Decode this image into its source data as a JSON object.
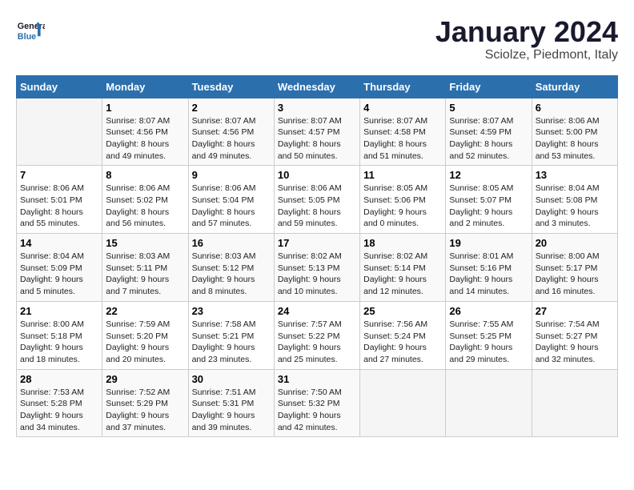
{
  "header": {
    "logo_general": "General",
    "logo_blue": "Blue",
    "month": "January 2024",
    "location": "Sciolze, Piedmont, Italy"
  },
  "weekdays": [
    "Sunday",
    "Monday",
    "Tuesday",
    "Wednesday",
    "Thursday",
    "Friday",
    "Saturday"
  ],
  "weeks": [
    [
      {
        "day": "",
        "sunrise": "",
        "sunset": "",
        "daylight": ""
      },
      {
        "day": "1",
        "sunrise": "Sunrise: 8:07 AM",
        "sunset": "Sunset: 4:56 PM",
        "daylight": "Daylight: 8 hours and 49 minutes."
      },
      {
        "day": "2",
        "sunrise": "Sunrise: 8:07 AM",
        "sunset": "Sunset: 4:56 PM",
        "daylight": "Daylight: 8 hours and 49 minutes."
      },
      {
        "day": "3",
        "sunrise": "Sunrise: 8:07 AM",
        "sunset": "Sunset: 4:57 PM",
        "daylight": "Daylight: 8 hours and 50 minutes."
      },
      {
        "day": "4",
        "sunrise": "Sunrise: 8:07 AM",
        "sunset": "Sunset: 4:58 PM",
        "daylight": "Daylight: 8 hours and 51 minutes."
      },
      {
        "day": "5",
        "sunrise": "Sunrise: 8:07 AM",
        "sunset": "Sunset: 4:59 PM",
        "daylight": "Daylight: 8 hours and 52 minutes."
      },
      {
        "day": "6",
        "sunrise": "Sunrise: 8:06 AM",
        "sunset": "Sunset: 5:00 PM",
        "daylight": "Daylight: 8 hours and 53 minutes."
      }
    ],
    [
      {
        "day": "7",
        "sunrise": "Sunrise: 8:06 AM",
        "sunset": "Sunset: 5:01 PM",
        "daylight": "Daylight: 8 hours and 55 minutes."
      },
      {
        "day": "8",
        "sunrise": "Sunrise: 8:06 AM",
        "sunset": "Sunset: 5:02 PM",
        "daylight": "Daylight: 8 hours and 56 minutes."
      },
      {
        "day": "9",
        "sunrise": "Sunrise: 8:06 AM",
        "sunset": "Sunset: 5:04 PM",
        "daylight": "Daylight: 8 hours and 57 minutes."
      },
      {
        "day": "10",
        "sunrise": "Sunrise: 8:06 AM",
        "sunset": "Sunset: 5:05 PM",
        "daylight": "Daylight: 8 hours and 59 minutes."
      },
      {
        "day": "11",
        "sunrise": "Sunrise: 8:05 AM",
        "sunset": "Sunset: 5:06 PM",
        "daylight": "Daylight: 9 hours and 0 minutes."
      },
      {
        "day": "12",
        "sunrise": "Sunrise: 8:05 AM",
        "sunset": "Sunset: 5:07 PM",
        "daylight": "Daylight: 9 hours and 2 minutes."
      },
      {
        "day": "13",
        "sunrise": "Sunrise: 8:04 AM",
        "sunset": "Sunset: 5:08 PM",
        "daylight": "Daylight: 9 hours and 3 minutes."
      }
    ],
    [
      {
        "day": "14",
        "sunrise": "Sunrise: 8:04 AM",
        "sunset": "Sunset: 5:09 PM",
        "daylight": "Daylight: 9 hours and 5 minutes."
      },
      {
        "day": "15",
        "sunrise": "Sunrise: 8:03 AM",
        "sunset": "Sunset: 5:11 PM",
        "daylight": "Daylight: 9 hours and 7 minutes."
      },
      {
        "day": "16",
        "sunrise": "Sunrise: 8:03 AM",
        "sunset": "Sunset: 5:12 PM",
        "daylight": "Daylight: 9 hours and 8 minutes."
      },
      {
        "day": "17",
        "sunrise": "Sunrise: 8:02 AM",
        "sunset": "Sunset: 5:13 PM",
        "daylight": "Daylight: 9 hours and 10 minutes."
      },
      {
        "day": "18",
        "sunrise": "Sunrise: 8:02 AM",
        "sunset": "Sunset: 5:14 PM",
        "daylight": "Daylight: 9 hours and 12 minutes."
      },
      {
        "day": "19",
        "sunrise": "Sunrise: 8:01 AM",
        "sunset": "Sunset: 5:16 PM",
        "daylight": "Daylight: 9 hours and 14 minutes."
      },
      {
        "day": "20",
        "sunrise": "Sunrise: 8:00 AM",
        "sunset": "Sunset: 5:17 PM",
        "daylight": "Daylight: 9 hours and 16 minutes."
      }
    ],
    [
      {
        "day": "21",
        "sunrise": "Sunrise: 8:00 AM",
        "sunset": "Sunset: 5:18 PM",
        "daylight": "Daylight: 9 hours and 18 minutes."
      },
      {
        "day": "22",
        "sunrise": "Sunrise: 7:59 AM",
        "sunset": "Sunset: 5:20 PM",
        "daylight": "Daylight: 9 hours and 20 minutes."
      },
      {
        "day": "23",
        "sunrise": "Sunrise: 7:58 AM",
        "sunset": "Sunset: 5:21 PM",
        "daylight": "Daylight: 9 hours and 23 minutes."
      },
      {
        "day": "24",
        "sunrise": "Sunrise: 7:57 AM",
        "sunset": "Sunset: 5:22 PM",
        "daylight": "Daylight: 9 hours and 25 minutes."
      },
      {
        "day": "25",
        "sunrise": "Sunrise: 7:56 AM",
        "sunset": "Sunset: 5:24 PM",
        "daylight": "Daylight: 9 hours and 27 minutes."
      },
      {
        "day": "26",
        "sunrise": "Sunrise: 7:55 AM",
        "sunset": "Sunset: 5:25 PM",
        "daylight": "Daylight: 9 hours and 29 minutes."
      },
      {
        "day": "27",
        "sunrise": "Sunrise: 7:54 AM",
        "sunset": "Sunset: 5:27 PM",
        "daylight": "Daylight: 9 hours and 32 minutes."
      }
    ],
    [
      {
        "day": "28",
        "sunrise": "Sunrise: 7:53 AM",
        "sunset": "Sunset: 5:28 PM",
        "daylight": "Daylight: 9 hours and 34 minutes."
      },
      {
        "day": "29",
        "sunrise": "Sunrise: 7:52 AM",
        "sunset": "Sunset: 5:29 PM",
        "daylight": "Daylight: 9 hours and 37 minutes."
      },
      {
        "day": "30",
        "sunrise": "Sunrise: 7:51 AM",
        "sunset": "Sunset: 5:31 PM",
        "daylight": "Daylight: 9 hours and 39 minutes."
      },
      {
        "day": "31",
        "sunrise": "Sunrise: 7:50 AM",
        "sunset": "Sunset: 5:32 PM",
        "daylight": "Daylight: 9 hours and 42 minutes."
      },
      {
        "day": "",
        "sunrise": "",
        "sunset": "",
        "daylight": ""
      },
      {
        "day": "",
        "sunrise": "",
        "sunset": "",
        "daylight": ""
      },
      {
        "day": "",
        "sunrise": "",
        "sunset": "",
        "daylight": ""
      }
    ]
  ]
}
